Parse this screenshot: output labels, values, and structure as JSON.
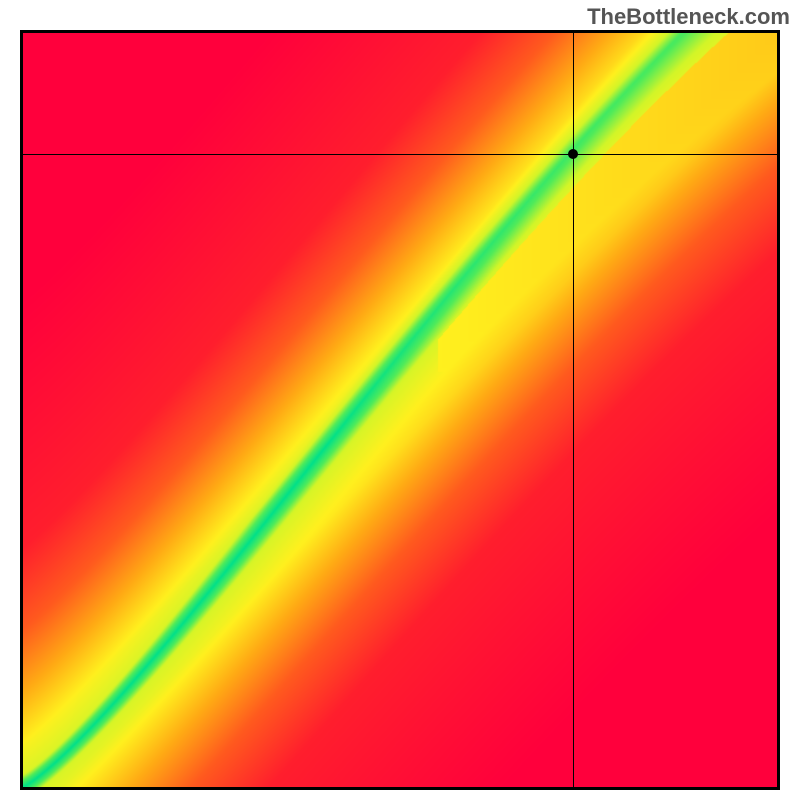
{
  "watermark": "TheBottleneck.com",
  "chart_data": {
    "type": "heatmap",
    "title": "",
    "xlabel": "",
    "ylabel": "",
    "xlim": [
      0,
      1
    ],
    "ylim": [
      0,
      1
    ],
    "colormap": "turbo-like (red→orange→yellow→green)",
    "marker": {
      "x": 0.73,
      "y": 0.84
    },
    "crosshair": {
      "x": 0.73,
      "y": 0.84
    },
    "note": "Heatmap shading represents proximity to an optimal diagonal band (green = best match). No axis ticks or numeric labels are rendered in the source image."
  }
}
